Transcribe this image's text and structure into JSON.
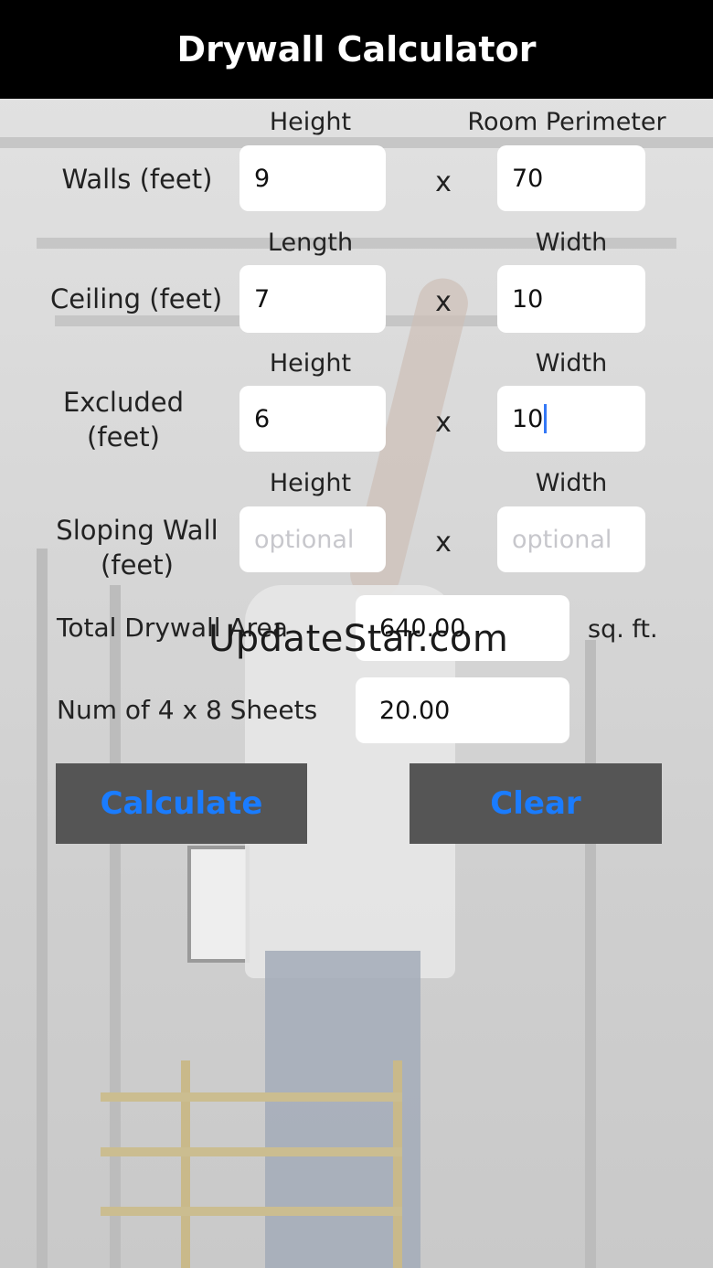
{
  "app": {
    "title": "Drywall Calculator"
  },
  "rows": {
    "walls": {
      "label": "Walls (feet)",
      "col1_header": "Height",
      "col2_header": "Room Perimeter",
      "value1": "9",
      "value2": "70"
    },
    "ceiling": {
      "label": "Ceiling (feet)",
      "col1_header": "Length",
      "col2_header": "Width",
      "value1": "7",
      "value2": "10"
    },
    "excluded": {
      "label_line1": "Excluded",
      "label_line2": "(feet)",
      "col1_header": "Height",
      "col2_header": "Width",
      "value1": "6",
      "value2": "10"
    },
    "sloping": {
      "label_line1": "Sloping Wall",
      "label_line2": "(feet)",
      "col1_header": "Height",
      "col2_header": "Width",
      "placeholder1": "optional",
      "placeholder2": "optional"
    }
  },
  "multiply_symbol": "x",
  "results": {
    "total_label": "Total Drywall Area",
    "total_value": "640.00",
    "total_unit": "sq. ft.",
    "sheets_label": "Num of 4 x 8 Sheets",
    "sheets_value": "20.00"
  },
  "buttons": {
    "calculate": "Calculate",
    "clear": "Clear"
  },
  "watermark": "UpdateStar.com",
  "colors": {
    "topbar": "#000000",
    "button_bg": "#555555",
    "button_text": "#1a7cff"
  }
}
